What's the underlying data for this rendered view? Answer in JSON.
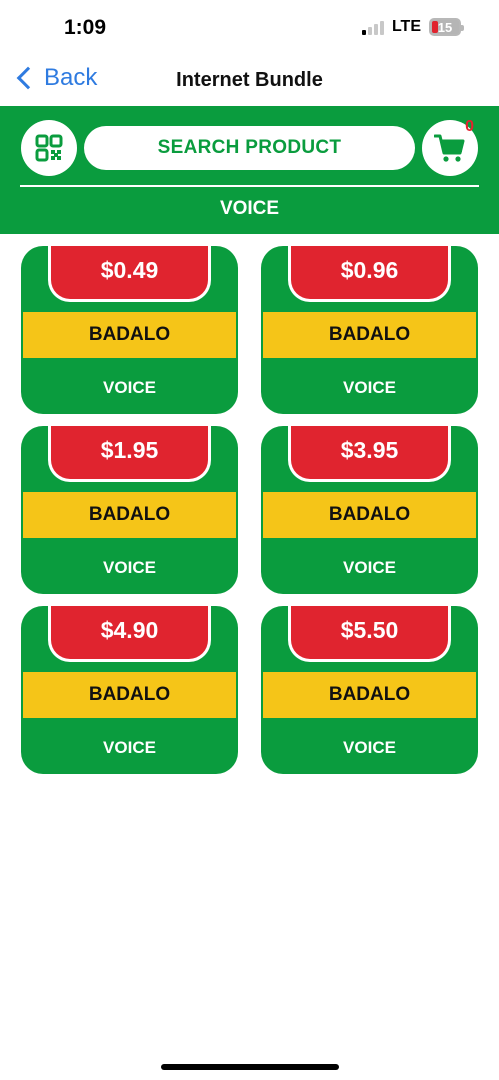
{
  "status_bar": {
    "time": "1:09",
    "network": "LTE",
    "battery": "15",
    "signal_icon": "signal-bars-icon",
    "battery_color": "#e0242f"
  },
  "nav": {
    "back_label": "Back",
    "title": "Internet Bundle"
  },
  "header": {
    "search_label": "SEARCH PRODUCT",
    "cart_count": "0",
    "category": "VOICE",
    "qr_icon": "qr-code-icon",
    "cart_icon": "shopping-cart-icon"
  },
  "colors": {
    "primary_green": "#0a9c3e",
    "price_red": "#e0242f",
    "brand_yellow": "#f5c518",
    "link_blue": "#2f7be0"
  },
  "products": [
    {
      "price": "$0.49",
      "brand": "BADALO",
      "type": "VOICE"
    },
    {
      "price": "$0.96",
      "brand": "BADALO",
      "type": "VOICE"
    },
    {
      "price": "$1.95",
      "brand": "BADALO",
      "type": "VOICE"
    },
    {
      "price": "$3.95",
      "brand": "BADALO",
      "type": "VOICE"
    },
    {
      "price": "$4.90",
      "brand": "BADALO",
      "type": "VOICE"
    },
    {
      "price": "$5.50",
      "brand": "BADALO",
      "type": "VOICE"
    }
  ]
}
